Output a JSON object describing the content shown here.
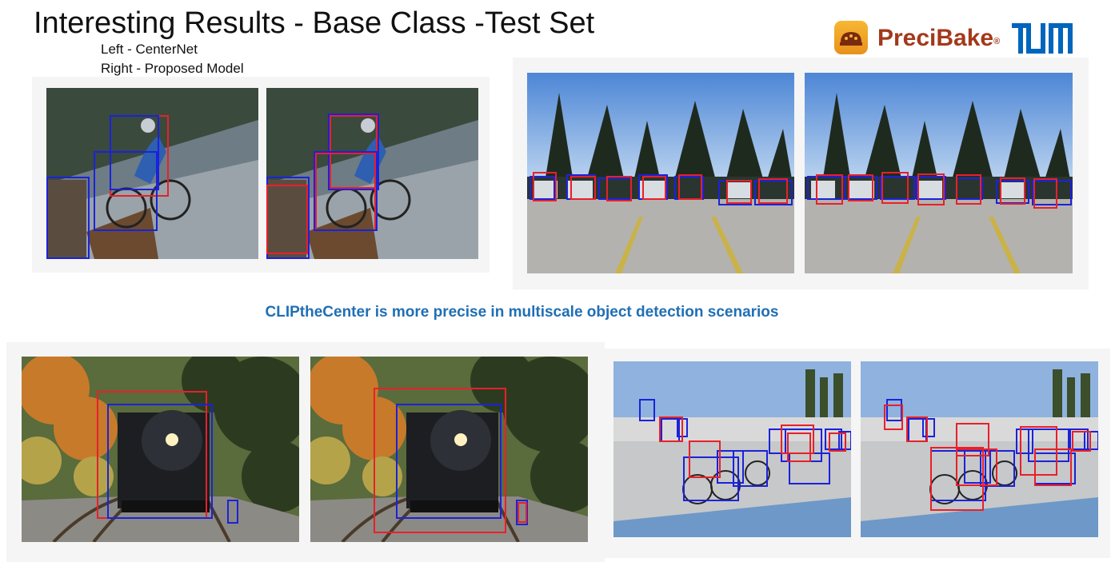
{
  "title": "Interesting Results - Base Class  -Test Set",
  "subtitle_left": "Left - CenterNet",
  "subtitle_right": "Right - Proposed Model",
  "caption": "CLIPtheCenter is more precise in multiscale object detection scenarios",
  "logo": {
    "brand": "PreciBake",
    "registered_mark": "®",
    "icon": "bread-icon",
    "university": "TUM"
  },
  "colors": {
    "caption": "#1f6fb5",
    "box_red": "#e8202a",
    "box_blue": "#1b22d9",
    "brand": "#a3391b",
    "tum_blue": "#0065bd"
  },
  "images": [
    {
      "name": "cyclist-centernet"
    },
    {
      "name": "cyclist-proposed"
    },
    {
      "name": "parking-centernet"
    },
    {
      "name": "parking-proposed"
    },
    {
      "name": "train-centernet"
    },
    {
      "name": "train-proposed"
    },
    {
      "name": "velodrome-centernet"
    },
    {
      "name": "velodrome-proposed"
    }
  ]
}
